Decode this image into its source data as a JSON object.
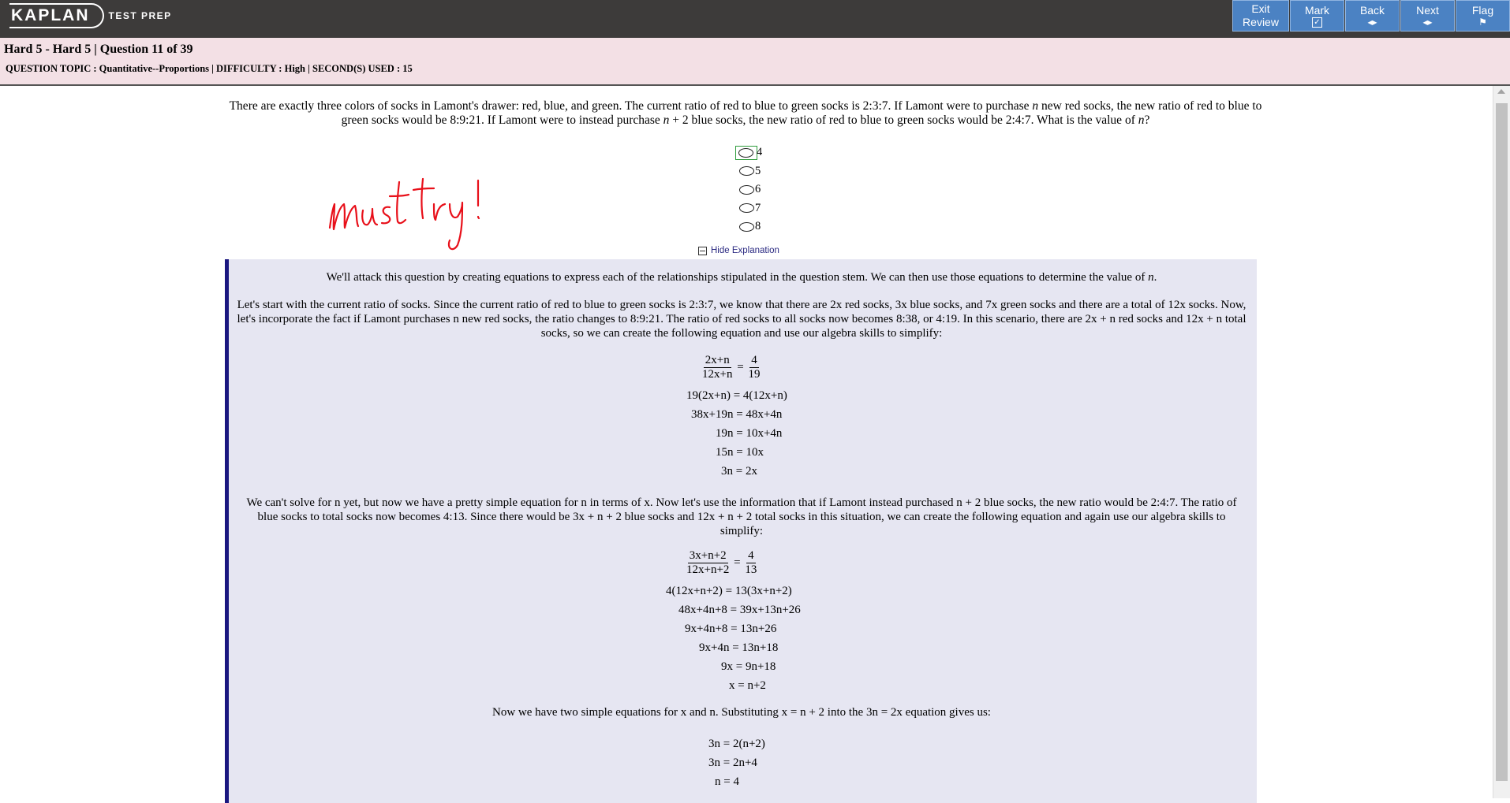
{
  "app": {
    "logo": "KAPLAN",
    "logo_sub": "TEST PREP"
  },
  "nav": {
    "exit_line1": "Exit",
    "exit_line2": "Review",
    "mark": "Mark",
    "back": "Back",
    "next": "Next",
    "flag": "Flag"
  },
  "header": {
    "title": "Hard 5 - Hard 5 | Question 11 of 39",
    "meta": "QUESTION TOPIC : Quantitative--Proportions | DIFFICULTY : High | SECOND(S) USED : 15"
  },
  "question": {
    "stem_part1": "There are exactly three colors of socks in Lamont's drawer: red, blue, and green. The current ratio of red to blue to green socks is 2:3:7. If Lamont were to purchase ",
    "stem_part2": " new red socks, the new ratio of red to blue to green socks would be 8:9:21. If Lamont were to instead purchase ",
    "stem_part3": " + 2 blue socks, the new ratio of red to blue to green socks would be 2:4:7. What is the value of ",
    "stem_part4": "?",
    "var": "n",
    "choices": [
      "4",
      "5",
      "6",
      "7",
      "8"
    ]
  },
  "annotation": {
    "handwriting": "must try!"
  },
  "explanation": {
    "toggle_label": "Hide Explanation",
    "p1a": "We'll attack this question by creating equations to express each of the relationships stipulated in the question stem. We can then use those equations to determine the value of ",
    "p1b": ".",
    "p2": "Let's start with the current ratio of socks. Since the current ratio of red to blue to green socks is 2:3:7, we know that there are 2x red socks, 3x blue socks, and 7x green socks and there are a total of 12x socks. Now, let's incorporate the fact if Lamont purchases n new red socks, the ratio changes to 8:9:21. The ratio of red socks to all socks now becomes 8:38, or 4:19. In this scenario, there are 2x + n red socks and 12x + n total socks, so we can create the following equation and use our algebra skills to simplify:",
    "eq1": {
      "num": "2x+n",
      "den": "12x+n",
      "rnum": "4",
      "rden": "19",
      "lines": [
        "19(2x+n) = 4(12x+n)",
        "38x+19n = 48x+4n",
        "19n = 10x+4n",
        "15n = 10x",
        "3n = 2x"
      ]
    },
    "p3": "We can't solve for n yet, but now we have a pretty simple equation for n in terms of x. Now let's use the information that if Lamont instead purchased n + 2 blue socks, the new ratio would be 2:4:7. The ratio of blue socks to total socks now becomes 4:13. Since there would be 3x + n + 2 blue socks and 12x + n + 2 total socks in this situation, we can create the following equation and again use our algebra skills to simplify:",
    "eq2": {
      "num": "3x+n+2",
      "den": "12x+n+2",
      "rnum": "4",
      "rden": "13",
      "lines": [
        "4(12x+n+2) = 13(3x+n+2)",
        "48x+4n+8 = 39x+13n+26",
        "9x+4n+8 = 13n+26",
        "9x+4n = 13n+18",
        "9x = 9n+18",
        "x = n+2"
      ]
    },
    "p4": "Now we have two simple equations for x and n. Substituting x = n + 2 into the 3n = 2x equation gives us:",
    "eq3": {
      "lines": [
        "3n = 2(n+2)",
        "3n = 2n+4",
        "n = 4"
      ]
    }
  }
}
